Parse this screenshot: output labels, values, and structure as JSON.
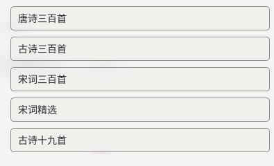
{
  "menu": {
    "items": [
      {
        "label": "唐诗三百首"
      },
      {
        "label": "古诗三百首"
      },
      {
        "label": "宋词三百首"
      },
      {
        "label": "宋词精选"
      },
      {
        "label": "古诗十九首"
      }
    ]
  }
}
